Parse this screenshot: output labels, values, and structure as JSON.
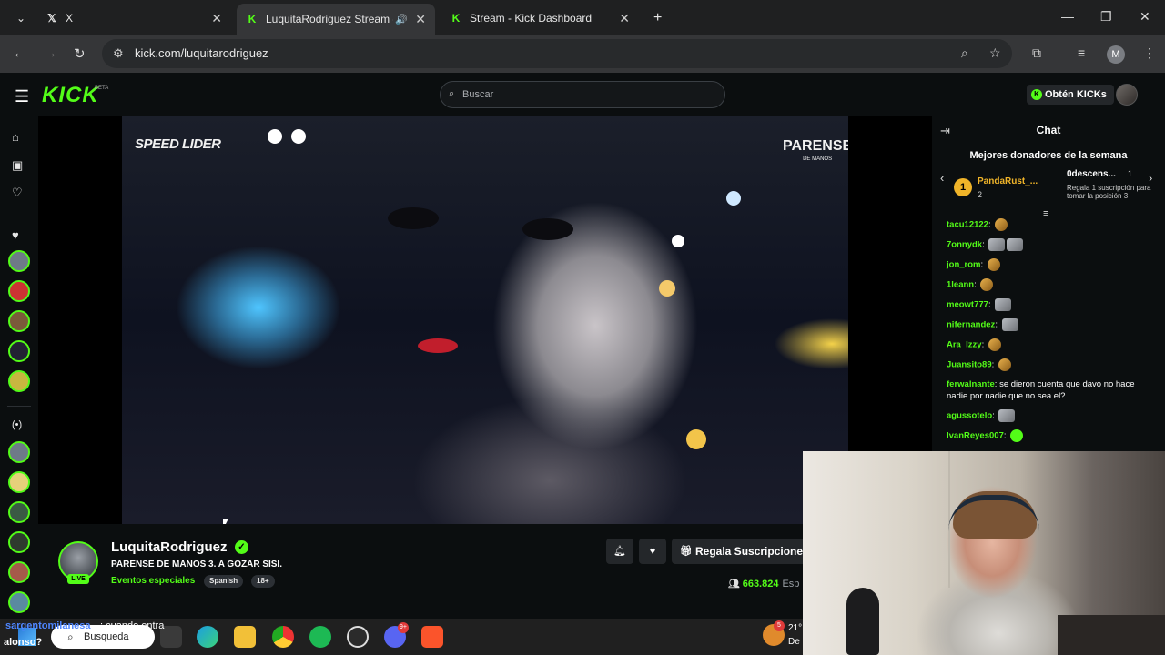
{
  "browser": {
    "tabs": [
      {
        "label": "X",
        "favicon": "x-logo"
      },
      {
        "label": "LuquitaRodriguez Stream -",
        "favicon": "kick-logo",
        "active": true
      },
      {
        "label": "Stream - Kick Dashboard",
        "favicon": "kick-logo"
      }
    ],
    "url": "kick.com/luquitarodriguez",
    "profile_initial": "M"
  },
  "header": {
    "logo": "KICK",
    "beta": "BETA",
    "search_placeholder": "Buscar",
    "kicks_button": "Obtén KICKs"
  },
  "video": {
    "overlay_left": "SPEED LIDER",
    "overlay_right": "PARENSE",
    "overlay_right_sub": "DE MANOS"
  },
  "stream": {
    "channel_name": "LuquitaRodriguez",
    "live_label": "LIVE",
    "title": "PARENSE DE MANOS 3. A GOZAR SISI.",
    "category": "Eventos especiales",
    "tags": [
      "Spanish",
      "18+"
    ],
    "gift_button": "Regala Suscripciones",
    "viewers": "663.824",
    "viewers_suffix": "Esp"
  },
  "chat": {
    "title": "Chat",
    "donors_title": "Mejores donadores de la semana",
    "donor1": {
      "rank": "1",
      "name": "PandaRust_...",
      "count": "2"
    },
    "donor2": {
      "name": "0descens...",
      "rank": "1",
      "note": "Regala 1 suscripción para tomar la posición 3"
    },
    "messages": [
      {
        "user": "tacu12122",
        "text": "",
        "emote": "dance"
      },
      {
        "user": "7onnydk",
        "text": "",
        "emote": "cat2"
      },
      {
        "user": "jon_rom",
        "text": "",
        "emote": "dance"
      },
      {
        "user": "1leann",
        "text": "",
        "emote": "dance"
      },
      {
        "user": "meowt777",
        "text": "",
        "emote": "cat"
      },
      {
        "user": "nifernandez",
        "text": "",
        "emote": "cat"
      },
      {
        "user": "Ara_Izzy",
        "text": "",
        "emote": "dance"
      },
      {
        "user": "Juansito89",
        "text": "",
        "emote": "dance"
      },
      {
        "user": "ferwalnante",
        "text": "se dieron cuenta que davo no hace nadie por nadie que no sea el?",
        "emote": ""
      },
      {
        "user": "agussotelo",
        "text": "",
        "emote": "cat"
      },
      {
        "user": "IvanReyes007",
        "text": "",
        "emote": "green"
      }
    ]
  },
  "taskbar": {
    "search_label": "Busqueda",
    "weather_temp": "21°",
    "weather_text": "De",
    "notif_count": "5",
    "discord_badge": "9+"
  },
  "overlay_chat": {
    "user": "sargentomilanesa",
    "message": ": cuando entra",
    "line2": "alonso?"
  }
}
